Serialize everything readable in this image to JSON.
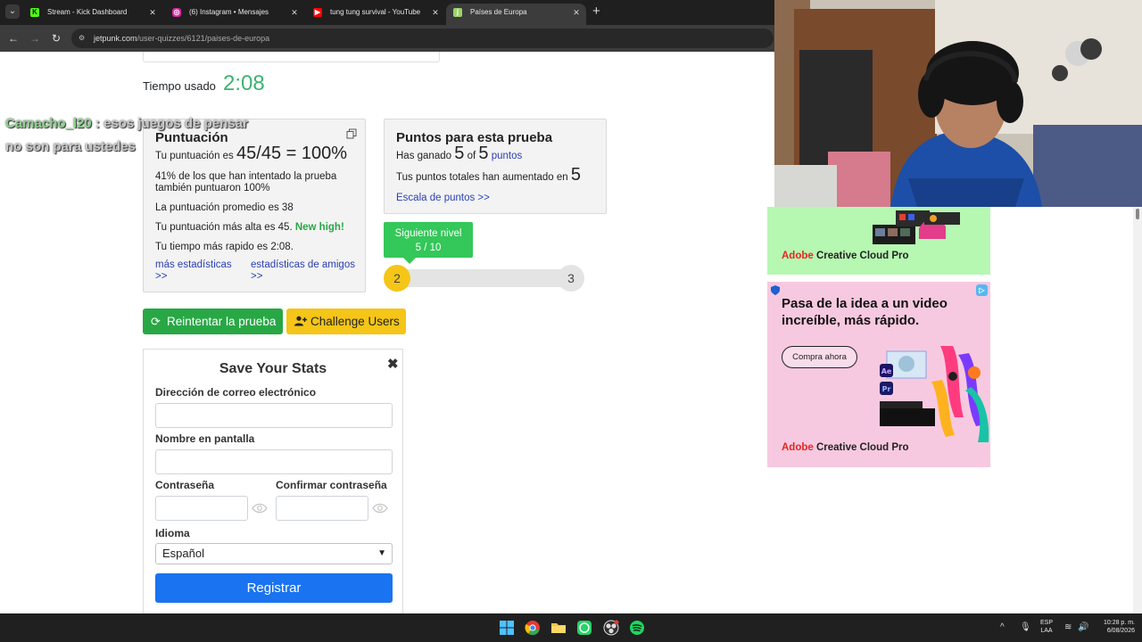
{
  "tabs": [
    {
      "title": "Stream - Kick Dashboard",
      "favicon": "kick-icon",
      "active": false
    },
    {
      "title": "(6) Instagram • Mensajes",
      "favicon": "instagram-icon",
      "active": false
    },
    {
      "title": "tung tung survival - YouTube",
      "favicon": "youtube-icon",
      "active": false
    },
    {
      "title": "Países de Europa",
      "favicon": "jetpunk-icon",
      "active": true
    }
  ],
  "address_bar": {
    "domain": "jetpunk.com",
    "path": "/user-quizzes/6121/paises-de-europa"
  },
  "timer": {
    "label": "Tiempo usado",
    "value": "2:08"
  },
  "chat_overlay": {
    "user": "Camacho_l20",
    "message_line1": " : esos juegos de pensar",
    "message_line2": "no son para ustedes"
  },
  "score": {
    "title": "Puntuación",
    "score_prefix": "Tu puntuación es",
    "score_value": "45/45 = 100%",
    "percent_line1": "41% de los que han intentado la prueba",
    "percent_line2": "también puntuaron 100%",
    "average": "La puntuación promedio es 38",
    "highest_prefix": "Tu puntuación más alta es 45.",
    "new_high": "New high!",
    "fastest": "Tu tiempo más rapido es 2:08.",
    "more_stats_1": "más estadísticas",
    "more_stats_2": ">>",
    "friend_stats_1": "estadísticas de amigos",
    "friend_stats_2": ">>"
  },
  "points": {
    "title": "Puntos para esta prueba",
    "earned_prefix": "Has ganado",
    "earned": "5",
    "of": "of",
    "total": "5",
    "unit": "puntos",
    "increase_prefix": "Tus puntos totales han aumentado en",
    "increase": "5",
    "scale_link": "Escala de puntos >>"
  },
  "level": {
    "tag_line1": "Siguiente nivel",
    "tag_line2": "5 / 10",
    "current": "2",
    "next": "3",
    "progress": 0.5
  },
  "buttons": {
    "retry": "Reintentar la prueba",
    "challenge": "Challenge Users"
  },
  "save_stats": {
    "title": "Save Your Stats",
    "email_label": "Dirección de correo electrónico",
    "screen_name_label": "Nombre en pantalla",
    "password_label": "Contraseña",
    "confirm_label": "Confirmar contraseña",
    "language_label": "Idioma",
    "language_value": "Español",
    "register": "Registrar"
  },
  "ads": {
    "brand_adobe": "Adobe",
    "brand_rest": " Creative Cloud Pro",
    "headline": "Pasa de la idea a un video increíble, más rápido.",
    "cta": "Compra ahora"
  },
  "taskbar": {
    "lang": "ESP",
    "layout": "LAA",
    "time": "10:28 p. m.",
    "date": "6/08/2026"
  },
  "colors": {
    "accent_green": "#28a745",
    "timer_green": "#3cb371",
    "yellow": "#f5c518",
    "register_blue": "#1a73f0",
    "link_blue": "#2a3fb2"
  }
}
